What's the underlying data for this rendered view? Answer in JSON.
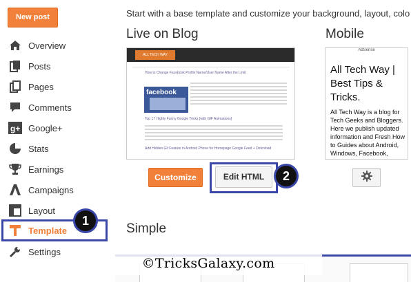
{
  "sidebar": {
    "new_post_label": "New post",
    "items": [
      {
        "label": "Overview",
        "icon": "home-icon"
      },
      {
        "label": "Posts",
        "icon": "posts-icon"
      },
      {
        "label": "Pages",
        "icon": "pages-icon"
      },
      {
        "label": "Comments",
        "icon": "comment-icon"
      },
      {
        "label": "Google+",
        "icon": "google-plus-icon"
      },
      {
        "label": "Stats",
        "icon": "stats-icon"
      },
      {
        "label": "Earnings",
        "icon": "trophy-icon"
      },
      {
        "label": "Campaigns",
        "icon": "campaigns-icon"
      },
      {
        "label": "Layout",
        "icon": "layout-icon"
      },
      {
        "label": "Template",
        "icon": "template-icon",
        "active": true
      },
      {
        "label": "Settings",
        "icon": "wrench-icon"
      }
    ]
  },
  "main": {
    "intro": "Start with a base template and customize your background, layout, colo",
    "live_title": "Live on Blog",
    "mobile_title": "Mobile",
    "simple_title": "Simple",
    "customize_label": "Customize",
    "edit_html_label": "Edit HTML",
    "desktop_preview": {
      "logo": "ALL TECH WAY",
      "post1_title": "How to Change Facebook Profile Name/User Name After the Limit",
      "facebook_text": "facebook",
      "post2_title": "Top 17 Highly Funny Google Tricks [with GIF Animations]",
      "post3_title": "Add Hidden Gif Feature in Android Phone for Homepage Google Feed + Download"
    },
    "mobile_preview": {
      "top_text": "AdSense",
      "title": "All Tech Way | Best Tips & Tricks.",
      "description": "All Tech Way is a blog for Tech Geeks and Bloggers. Here we publish updated information and Fresh How to Guides about Android, Windows, Facebook, Blogging, Computer Tricks & Tips,"
    }
  },
  "annotations": {
    "badge1": "1",
    "badge2": "2"
  },
  "watermark": "©TricksGalaxy.com",
  "colors": {
    "accent": "#f1803a",
    "highlight": "#3a46a8"
  }
}
